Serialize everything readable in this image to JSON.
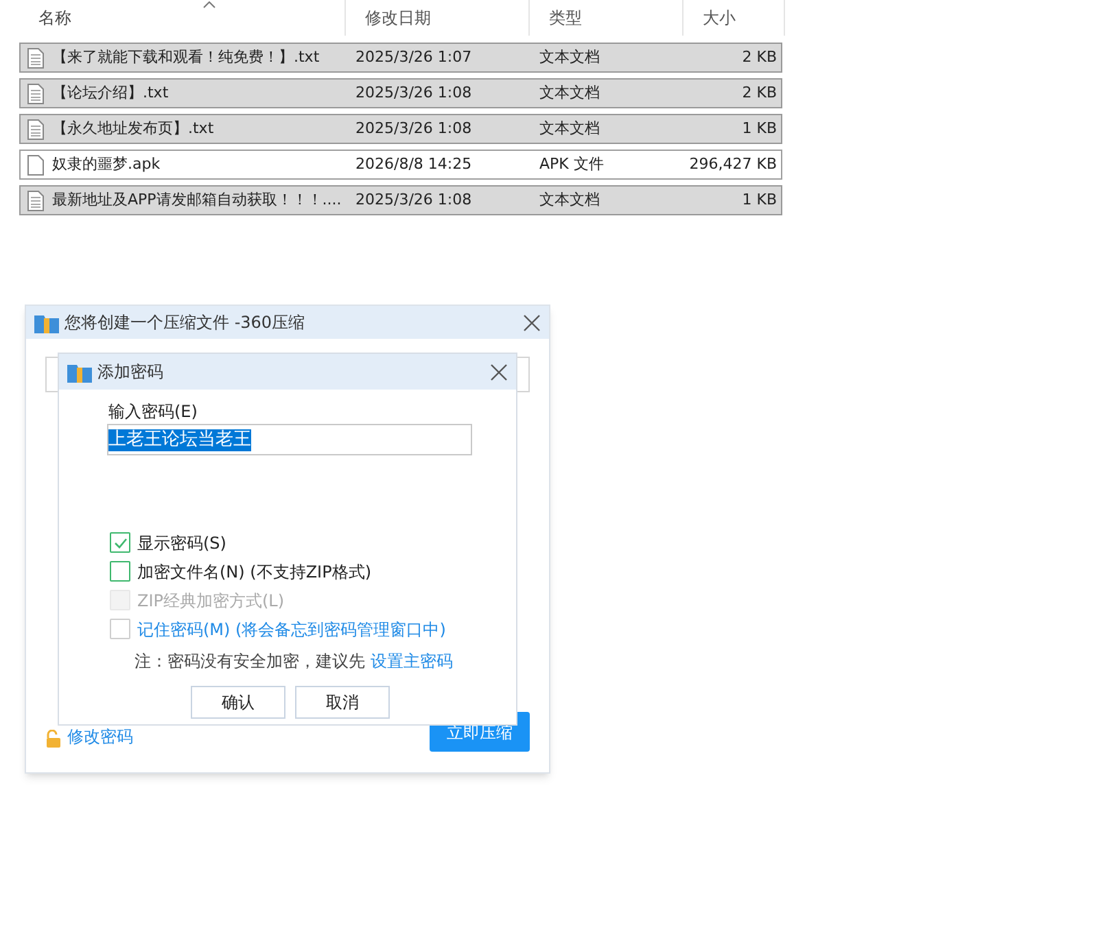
{
  "explorer": {
    "columns": [
      {
        "label": "名称",
        "sorted": true
      },
      {
        "label": "修改日期",
        "sorted": false
      },
      {
        "label": "类型",
        "sorted": false
      },
      {
        "label": "大小",
        "sorted": false
      }
    ],
    "rows": [
      {
        "name": "【来了就能下载和观看！纯免费！】.txt",
        "date": "2025/3/26 1:07",
        "type": "文本文档",
        "size": "2 KB",
        "selected": true,
        "kind": "text"
      },
      {
        "name": "【论坛介绍】.txt",
        "date": "2025/3/26 1:08",
        "type": "文本文档",
        "size": "2 KB",
        "selected": true,
        "kind": "text"
      },
      {
        "name": "【永久地址发布页】.txt",
        "date": "2025/3/26 1:08",
        "type": "文本文档",
        "size": "1 KB",
        "selected": true,
        "kind": "text"
      },
      {
        "name": "奴隶的噩梦.apk",
        "date": "2026/8/8 14:25",
        "type": "APK 文件",
        "size": "296,427 KB",
        "selected": false,
        "kind": "blank"
      },
      {
        "name": "最新地址及APP请发邮箱自动获取！！！....",
        "date": "2025/3/26 1:08",
        "type": "文本文档",
        "size": "1 KB",
        "selected": true,
        "kind": "text"
      }
    ]
  },
  "compress_dialog": {
    "title": "您将创建一个压缩文件 -360压缩",
    "change_password": "修改密码",
    "compress_button": "立即压缩"
  },
  "password_dialog": {
    "title": "添加密码",
    "password_label": "输入密码(E)",
    "password_value": "上老王论坛当老王",
    "options": [
      {
        "label": "显示密码(S)",
        "checked": true,
        "disabled": false,
        "link": false
      },
      {
        "label": "加密文件名(N) (不支持ZIP格式)",
        "checked": false,
        "disabled": false,
        "link": false
      },
      {
        "label": "ZIP经典加密方式(L)",
        "checked": false,
        "disabled": true,
        "link": false
      },
      {
        "label": "记住密码(M) (将会备忘到密码管理窗口中)",
        "checked": false,
        "disabled": false,
        "link": true
      }
    ],
    "note": "注：密码没有安全加密，建议先 ",
    "note_link": "设置主密码",
    "buttons": [
      "确认",
      "取消"
    ]
  }
}
